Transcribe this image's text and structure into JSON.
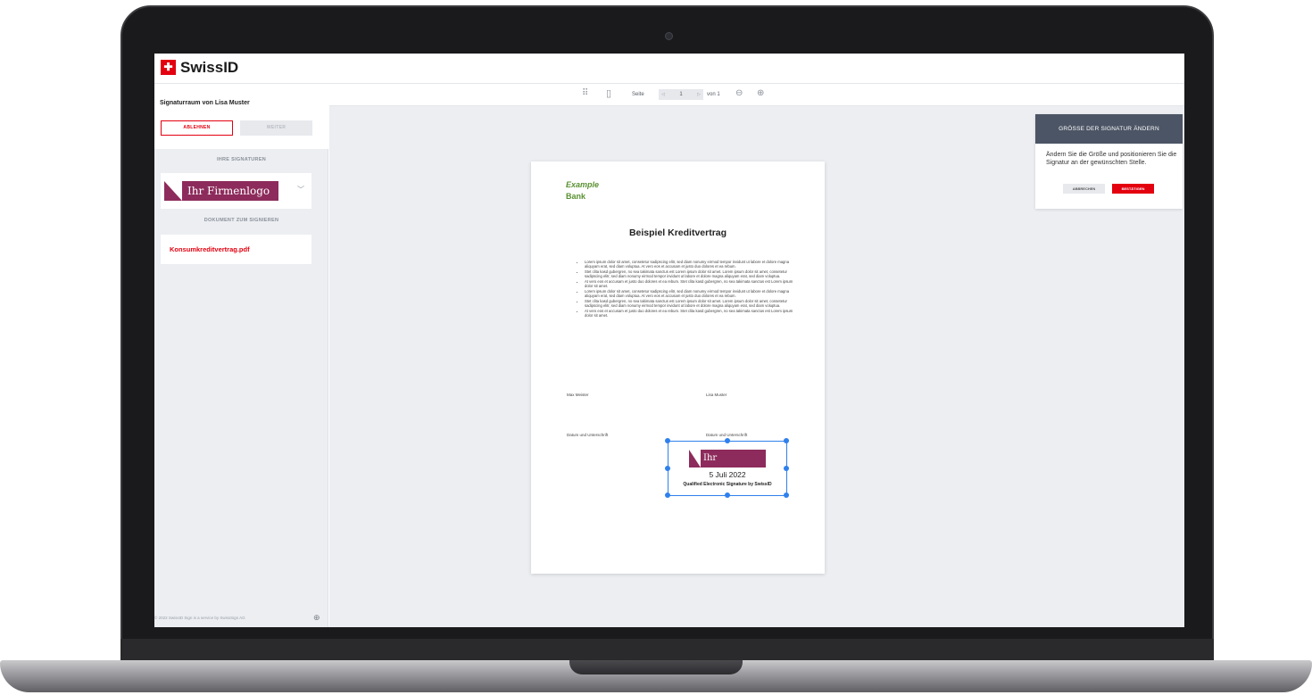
{
  "app": {
    "name": "SwissID",
    "logo_glyph": "✚"
  },
  "sidebar": {
    "room_title": "Signaturraum von Lisa Muster",
    "decline_label": "ABLEHNEN",
    "next_label": "WEITER",
    "signatures_heading": "IHRE SIGNATUREN",
    "signature_logo_text": "Ihr Firmenlogo",
    "document_heading": "DOKUMENT ZUM SIGNIEREN",
    "document_name": "Konsumkreditvertrag.pdf",
    "footer": "© 2022 SwissID Sign is a service by SwissSign AG"
  },
  "toolbar": {
    "page_label": "Seite",
    "page_number": "1",
    "of_label": "von 1",
    "icons": [
      "grid-view-icon",
      "single-page-icon",
      "prev-page-icon",
      "next-page-icon",
      "zoom-out-icon",
      "zoom-in-icon"
    ]
  },
  "document": {
    "bank_line1": "Example",
    "bank_line2": "Bank",
    "title": "Beispiel Kreditvertrag",
    "bullets": [
      "Lorem ipsum dolor sit amet, consetetur sadipscing elitr, sed diam nonumy eirmod tempor invidunt ut labore et dolore magna aliquyam erat, sed diam voluptua. At vero eos et accusam et justo duo dolores et ea rebum.",
      "Stet clita kasd gubergren, no sea takimata sanctus est Lorem ipsum dolor sit amet. Lorem ipsum dolor sit amet, consetetur sadipscing elitr, sed diam nonumy eirmod tempor invidunt ut labore et dolore magna aliquyam erat, sed diam voluptua.",
      "At vero eos et accusam et justo duo dolores et ea rebum. Stet clita kasd gubergren, no sea takimata sanctus est Lorem ipsum dolor sit amet.",
      "Lorem ipsum dolor sit amet, consetetur sadipscing elitr, sed diam nonumy eirmod tempor invidunt ut labore et dolore magna aliquyam erat, sed diam voluptua. At vero eos et accusam et justo duo dolores et ea rebum.",
      "Stet clita kasd gubergren, no sea takimata sanctus est Lorem ipsum dolor sit amet. Lorem ipsum dolor sit amet, consetetur sadipscing elitr, sed diam nonumy eirmod tempor invidunt ut labore et dolore magna aliquyam erat, sed diam voluptua.",
      "At vero eos et accusam et justo duo dolores et ea rebum. Stet clita kasd gubergren, no sea takimata sanctus est Lorem ipsum dolor sit amet."
    ],
    "signer_left": "Max Meister",
    "signer_right": "Lisa Muster",
    "date_sig_left": "Datum und Unterschrift",
    "date_sig_right": "Datum und Unterschrift",
    "placed_signature": {
      "logo_text": "Ihr Firmenlogo",
      "date": "5 Juli 2022",
      "caption": "Qualified Electronic Signature by SwissID"
    }
  },
  "resize_panel": {
    "heading": "GRÖSSE DER SIGNATUR ÄNDERN",
    "text": "Ändern Sie die Größe und positionieren Sie die Signatur an der gewünschten Stelle.",
    "cancel_label": "ABBRECHEN",
    "confirm_label": "BESTÄTIGEN"
  },
  "colors": {
    "brand_red": "#e3000f",
    "logo_purple": "#8d2b5c",
    "bank_green": "#5a9132",
    "panel_header": "#4c5565",
    "handle_blue": "#2f80ed"
  }
}
